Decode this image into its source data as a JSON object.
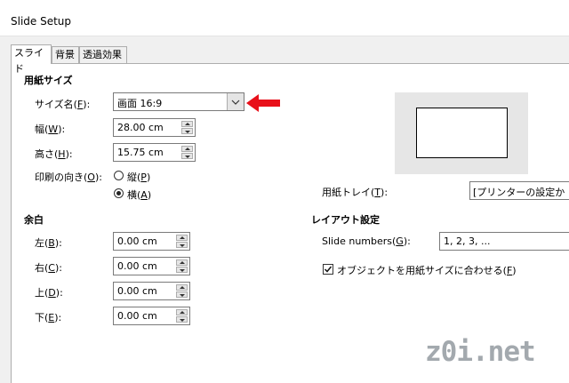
{
  "window": {
    "title": "Slide Setup"
  },
  "tabs": [
    {
      "label": "スライド",
      "active": true
    },
    {
      "label": "背景",
      "active": false
    },
    {
      "label": "透過効果",
      "active": false
    }
  ],
  "paper": {
    "heading": "用紙サイズ",
    "size": {
      "label": "サイズ名(",
      "key": "F",
      "suffix": "):",
      "value": "画面 16:9"
    },
    "width": {
      "label": "幅(",
      "key": "W",
      "suffix": "):",
      "value": "28.00 cm"
    },
    "height": {
      "label": "高さ(",
      "key": "H",
      "suffix": "):",
      "value": "15.75 cm"
    },
    "orientation": {
      "label": "印刷の向き(",
      "key": "O",
      "suffix": "):",
      "portrait": {
        "label": "縦(",
        "key": "P",
        "suffix": ")",
        "checked": false
      },
      "landscape": {
        "label": "横(",
        "key": "A",
        "suffix": ")",
        "checked": true
      }
    },
    "tray": {
      "label": "用紙トレイ(",
      "key": "T",
      "suffix": "):",
      "value": "[プリンターの設定から]"
    }
  },
  "margins": {
    "heading": "余白",
    "left": {
      "label": "左(",
      "key": "B",
      "suffix": "):",
      "value": "0.00 cm"
    },
    "right": {
      "label": "右(",
      "key": "C",
      "suffix": "):",
      "value": "0.00 cm"
    },
    "top": {
      "label": "上(",
      "key": "D",
      "suffix": "):",
      "value": "0.00 cm"
    },
    "bottom": {
      "label": "下(",
      "key": "E",
      "suffix": "):",
      "value": "0.00 cm"
    }
  },
  "layout": {
    "heading": "レイアウト設定",
    "slide_numbers": {
      "label": "Slide numbers(",
      "key": "G",
      "suffix": "):",
      "value": "1, 2, 3, ..."
    },
    "fit_object": {
      "label": "オブジェクトを用紙サイズに合わせる(",
      "key": "F",
      "suffix": ")",
      "checked": true
    }
  },
  "annotation": {
    "arrow_color": "#e8101a"
  },
  "watermark": "z0i.net"
}
